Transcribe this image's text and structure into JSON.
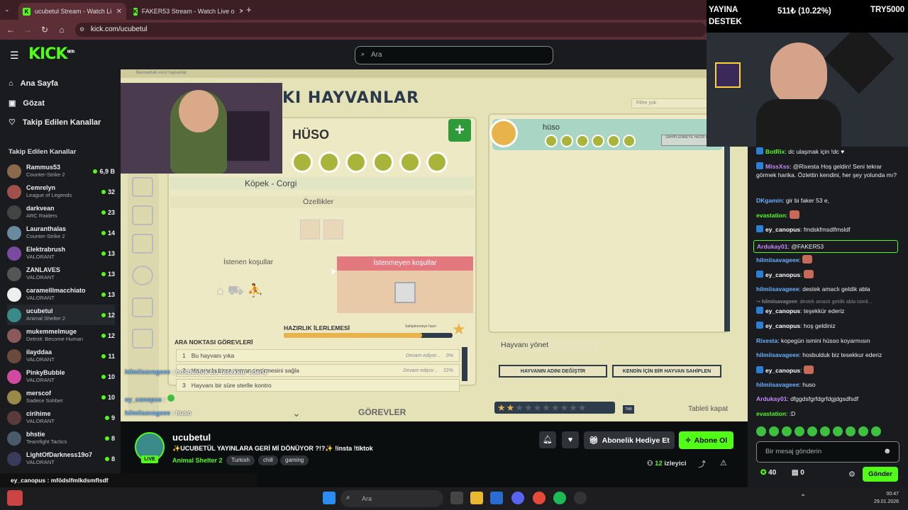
{
  "browser": {
    "tabs": [
      {
        "title": "ucubetul Stream - Watch Li",
        "active": true
      },
      {
        "title": "FAKER53 Stream - Watch Live o",
        "active": false
      }
    ],
    "url": "kick.com/ucubetul"
  },
  "header": {
    "logo": "KICK",
    "logo_sup": "BETA",
    "search_placeholder": "Ara"
  },
  "sidebar": {
    "nav": [
      {
        "label": "Ana Sayfa",
        "icon": "home-icon"
      },
      {
        "label": "Gözat",
        "icon": "browse-icon"
      },
      {
        "label": "Takip Edilen Kanallar",
        "icon": "heart-icon"
      }
    ],
    "following_header": "Takip Edilen Kanallar",
    "channels": [
      {
        "name": "Rammus53",
        "game": "Counter-Strike 2",
        "viewers": "6,9 B",
        "color": "#8a6a4a"
      },
      {
        "name": "Cemrelyn",
        "game": "League of Legends",
        "viewers": "32",
        "color": "#a0524a"
      },
      {
        "name": "darkvean",
        "game": "ARC Raiders",
        "viewers": "23",
        "color": "#444444"
      },
      {
        "name": "Lauranthalas",
        "game": "Counter-Strike 2",
        "viewers": "14",
        "color": "#6a8aa0"
      },
      {
        "name": "Elektrabrush",
        "game": "VALORANT",
        "viewers": "13",
        "color": "#7a4aa0"
      },
      {
        "name": "ZANLAVES",
        "game": "VALORANT",
        "viewers": "13",
        "color": "#555555"
      },
      {
        "name": "caramelllmacchiato",
        "game": "VALORANT",
        "viewers": "13",
        "color": "#eeeeee"
      },
      {
        "name": "ucubetul",
        "game": "Animal Shelter 2",
        "viewers": "12",
        "color": "#3a8a8a"
      },
      {
        "name": "mukemmelmuge",
        "game": "Detroit: Become Human",
        "viewers": "12",
        "color": "#8a5a5a"
      },
      {
        "name": "ilayddaa",
        "game": "VALORANT",
        "viewers": "11",
        "color": "#6a4a3a"
      },
      {
        "name": "PinkyBubble",
        "game": "VALORANT",
        "viewers": "10",
        "color": "#d04aa0"
      },
      {
        "name": "merscof",
        "game": "Sadece Sohbet",
        "viewers": "10",
        "color": "#9a8a4a"
      },
      {
        "name": "cirihime",
        "game": "VALORANT",
        "viewers": "9",
        "color": "#5a3a3a"
      },
      {
        "name": "bhstie",
        "game": "Teamfight Tactics",
        "viewers": "8",
        "color": "#4a5a6a"
      },
      {
        "name": "LightOfDarkness19o7",
        "game": "VALORANT",
        "viewers": "8",
        "color": "#3a3a5a"
      }
    ]
  },
  "game": {
    "breadcrumb": "Barınaktaki evcil hayvanlar",
    "title": "KI HAYVANLAR",
    "pet_name": "HÜSO",
    "breed": "Köpek - Corgi",
    "properties_label": "Özellikler",
    "wanted_label": "İstenen koşullar",
    "unwanted_label": "İstenmeyen koşullar",
    "progress_label": "HAZIRLIK İLERLEMESİ",
    "progress_marker_label": "Sahiplenmeye hazır",
    "progress_fraction": 0.82,
    "tasks_title": "ARA NOKTASI GÖREVLERİ",
    "tasks": [
      {
        "num": "1",
        "text": "Bu hayvanı yıka",
        "status": "Devam ediyor...",
        "pct": "0%"
      },
      {
        "num": "2",
        "text": "Hayvanla biraz zaman geçirmesini sağla",
        "status": "Devam ediyor...",
        "pct": "22%"
      },
      {
        "num": "3",
        "text": "Hayvanı bir süre sterlle kontro",
        "status": "",
        "pct": ""
      }
    ],
    "tasks_footer": "GÖREVLER",
    "filter_placeholder": "Filtre yok",
    "chip_name": "hüso",
    "chip_status": "SAHİPLENMEYE HAZIR DEĞİL",
    "manage_label": "Hayvanı yönet",
    "rename_button": "HAYVANIN ADINI DEĞİŞTİR",
    "adopt_button": "KENDİN İÇİN BİR HAYVAN SAHİPLEN",
    "tablet_label": "Tableti kapat",
    "tab_key": "TAB"
  },
  "stream_overlay_chat": [
    {
      "user": "hilmiisavageee",
      "text": "hosbulduk biz tesekkur ederiz"
    },
    {
      "user": "ey_canopus",
      "text": ""
    },
    {
      "user": "hilmiisavageee",
      "text": "huso"
    }
  ],
  "channel": {
    "name": "ucubetul",
    "live_badge": "LIVE",
    "title": "✨UCUBETÜL YAYINLARA GERİ Mİ DÖNÜYOR ?!?✨ !insta !tiktok",
    "category": "Animal Shelter 2",
    "tags": [
      "Turkish",
      "chill",
      "gaming"
    ],
    "gift_button": "Abonelik Hediye Et",
    "subscribe_button": "Abone Ol",
    "viewers": "12",
    "viewers_label": "izleyici"
  },
  "donation_overlay": {
    "line1": "YAYINA",
    "line2": "DESTEK",
    "amount": "511₺ (10.22%)",
    "goal": "TRY5000"
  },
  "chat": {
    "messages": [
      {
        "user": "BotRix",
        "color": "#53fc18",
        "badge": true,
        "text": "dc ulaşmak için !dc ♥"
      },
      {
        "user": "MissXss",
        "color": "#c58af9",
        "badge": true,
        "text": "@Rixesta Hoş geldin! Seni tekrar görmek harika. Özlettin kendini, her şey yolunda mı?"
      },
      {
        "user": "DKgamin",
        "color": "#6ab0ff",
        "badge": false,
        "text": "gir bi faker 53 e,"
      },
      {
        "user": "evastation",
        "color": "#53fc18",
        "badge": false,
        "text": ""
      },
      {
        "user": "ey_canopus",
        "color": "#ffffff",
        "badge": true,
        "text": "fmdskfmsdlfmsldf"
      },
      {
        "user": "Ardukay01",
        "color": "#c58af9",
        "badge": false,
        "text": "@FAKER53",
        "highlight": true
      },
      {
        "user": "hilmiisavageee",
        "color": "#6ab0ff",
        "badge": false,
        "text": ""
      },
      {
        "user": "ey_canopus",
        "color": "#ffffff",
        "badge": true,
        "text": ""
      },
      {
        "user": "hilmiisavageee",
        "color": "#6ab0ff",
        "badge": false,
        "text": "destek amaclı geldik abla"
      },
      {
        "user": "hilmiisavageee",
        "color": "#888888",
        "badge": false,
        "text": "destek amaclı geldik abla isimli...",
        "reply": true
      },
      {
        "user": "ey_canopus",
        "color": "#ffffff",
        "badge": true,
        "text": "teşekkür ederiz"
      },
      {
        "user": "ey_canopus",
        "color": "#ffffff",
        "badge": true,
        "text": "hoş geldiniz"
      },
      {
        "user": "Rixesta",
        "color": "#6ab0ff",
        "badge": false,
        "text": "kopegün ismini hüsso koyarmısın"
      },
      {
        "user": "hilmiisavageee",
        "color": "#6ab0ff",
        "badge": false,
        "text": "hosbulduk biz tesekkur ederiz"
      },
      {
        "user": "ey_canopus",
        "color": "#ffffff",
        "badge": true,
        "text": ""
      },
      {
        "user": "hilmiisavageee",
        "color": "#6ab0ff",
        "badge": false,
        "text": "huso"
      },
      {
        "user": "Ardukay01",
        "color": "#c58af9",
        "badge": false,
        "text": "dfggdsfgrfdgrfdgjdgsdfsdf"
      },
      {
        "user": "evastation",
        "color": "#53fc18",
        "badge": false,
        "text": ":D"
      }
    ],
    "input_placeholder": "Bir mesaj gönderin",
    "send_button": "Gönder",
    "points": "40",
    "drops": "0"
  },
  "bottom_overlay": {
    "user": "ey_canopus",
    "text": "mfödslfmlkdsmflsdf"
  },
  "taskbar": {
    "search_placeholder": "Ara",
    "time": "00:47",
    "date": "29.01.2026"
  }
}
